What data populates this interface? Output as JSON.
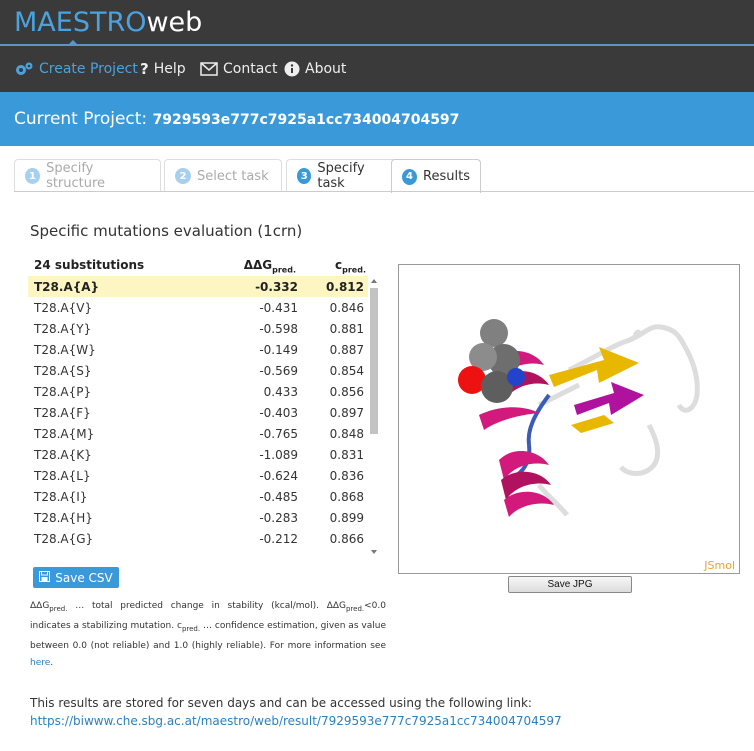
{
  "brand": {
    "part1": "MAESTRO",
    "part2": "web"
  },
  "nav": {
    "create_project": "Create Project",
    "help": "Help",
    "contact": "Contact",
    "about": "About"
  },
  "project": {
    "label": "Current Project: ",
    "id": "7929593e777c7925a1cc734004704597"
  },
  "tabs": [
    {
      "num": "1",
      "label": "Specify structure"
    },
    {
      "num": "2",
      "label": "Select task"
    },
    {
      "num": "3",
      "label": "Specify task"
    },
    {
      "num": "4",
      "label": "Results"
    }
  ],
  "section_title": "Specific mutations evaluation (1crn)",
  "table": {
    "header": {
      "col1": "24 substitutions",
      "col2_main": "ΔΔG",
      "col2_sub": "pred.",
      "col3_main": "c",
      "col3_sub": "pred."
    },
    "rows": [
      {
        "mut": "T28.A{A}",
        "ddg": "-0.332",
        "c": "0.812"
      },
      {
        "mut": "T28.A{V}",
        "ddg": "-0.431",
        "c": "0.846"
      },
      {
        "mut": "T28.A{Y}",
        "ddg": "-0.598",
        "c": "0.881"
      },
      {
        "mut": "T28.A{W}",
        "ddg": "-0.149",
        "c": "0.887"
      },
      {
        "mut": "T28.A{S}",
        "ddg": "-0.569",
        "c": "0.854"
      },
      {
        "mut": "T28.A{P}",
        "ddg": "0.433",
        "c": "0.856"
      },
      {
        "mut": "T28.A{F}",
        "ddg": "-0.403",
        "c": "0.897"
      },
      {
        "mut": "T28.A{M}",
        "ddg": "-0.765",
        "c": "0.848"
      },
      {
        "mut": "T28.A{K}",
        "ddg": "-1.089",
        "c": "0.831"
      },
      {
        "mut": "T28.A{L}",
        "ddg": "-0.624",
        "c": "0.836"
      },
      {
        "mut": "T28.A{I}",
        "ddg": "-0.485",
        "c": "0.868"
      },
      {
        "mut": "T28.A{H}",
        "ddg": "-0.283",
        "c": "0.899"
      },
      {
        "mut": "T28.A{G}",
        "ddg": "-0.212",
        "c": "0.866"
      }
    ]
  },
  "save_csv": "Save CSV",
  "legend": {
    "ddg": "ΔΔG",
    "pred": "pred.",
    "t1": " … total predicted change in stability (kcal/mol). ",
    "t2": "<0.0 indicates a stabilizing mutation. ",
    "c": "c",
    "t3": " … confidence estimation, given as value between 0.0 (not reliable) and 1.0 (highly reliable). For more information see ",
    "here": "here",
    "t4": "."
  },
  "viewer": {
    "jsmol": "JSmol",
    "save_jpg": "Save JPG"
  },
  "stored_text": "This results are stored for seven days and can be accessed using the following link:",
  "stored_link": "https://biwww.che.sbg.ac.at/maestro/web/result/7929593e777c7925a1cc734004704597",
  "colors": {
    "accent": "#3a9ad9",
    "topbar": "#3a3a3a",
    "highlight_row": "#fdf6c3"
  }
}
